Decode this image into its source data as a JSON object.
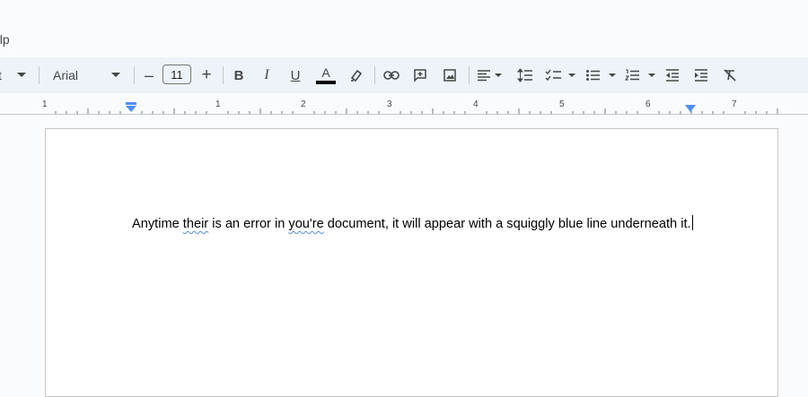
{
  "menubar": {
    "help_label": "elp"
  },
  "toolbar": {
    "styles_label": "t",
    "font_name": "Arial",
    "font_size": "11",
    "decrease_font_label": "–",
    "increase_font_label": "+",
    "bold_label": "B",
    "italic_label": "I",
    "underline_label": "U",
    "text_color_label": "A",
    "text_color": "#000000"
  },
  "ruler": {
    "numbers": [
      "1",
      "1",
      "2",
      "3",
      "4",
      "5",
      "6",
      "7"
    ]
  },
  "document": {
    "text_1": "Anytime ",
    "text_2": "their",
    "text_3": " is an error in ",
    "text_4": "you're",
    "text_5": " document, it will appear with a squiggly blue line underneath it."
  },
  "colors": {
    "toolbar_bg": "#eef2f9",
    "accent": "#4f8ef7",
    "page_bg": "#ffffff"
  }
}
